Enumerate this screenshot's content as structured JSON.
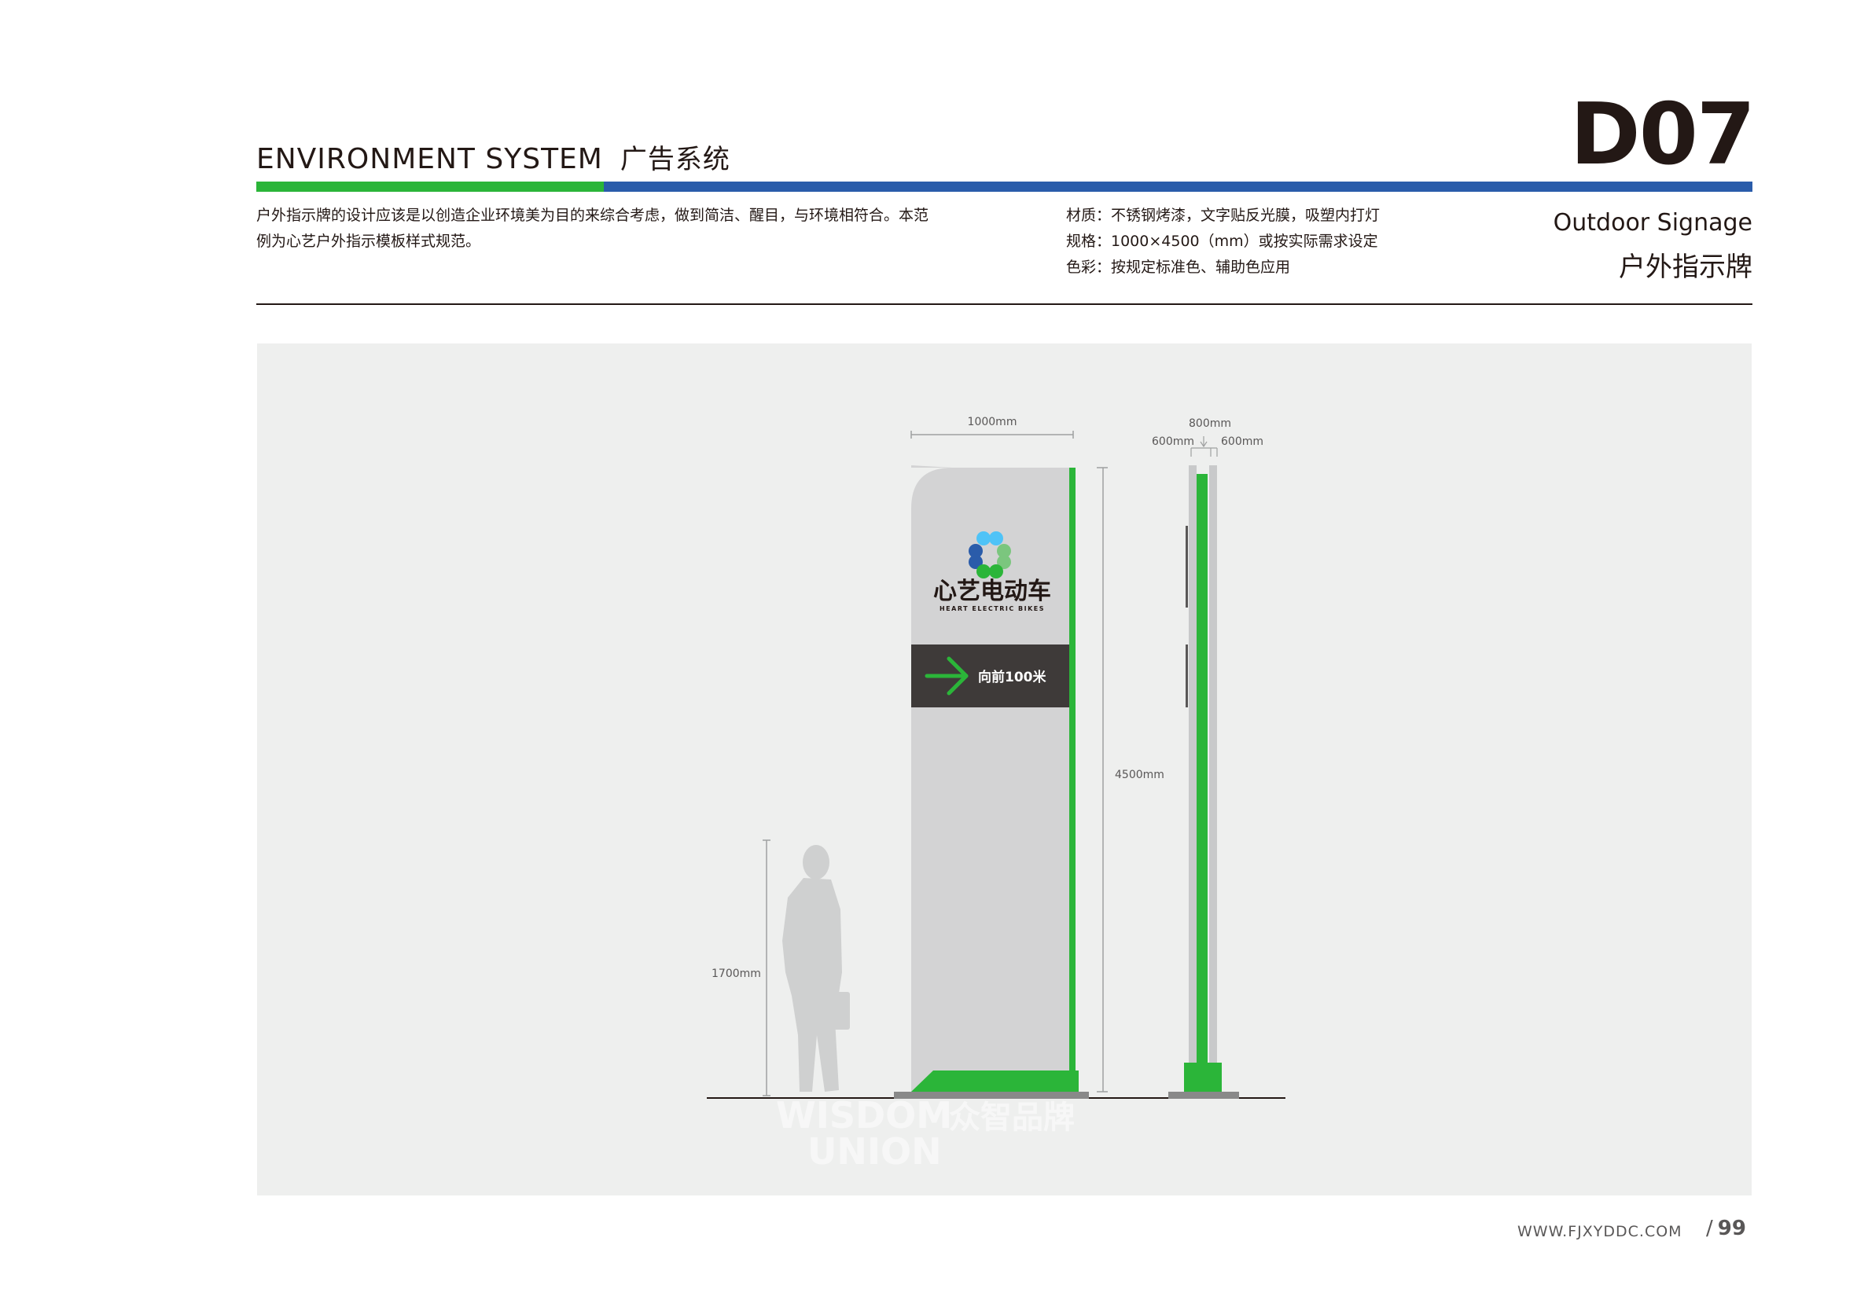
{
  "header": {
    "title_en": "ENVIRONMENT SYSTEM",
    "title_cn": "广告系统",
    "code": "D07"
  },
  "intro": {
    "lines": [
      "户外指示牌的设计应该是以创造企业环境美为目的来综合考虑，做到简洁、醒目，与环境相符合。本范",
      "例为心艺户外指示模板样式规范。"
    ]
  },
  "specs": {
    "material": "材质：不锈钢烤漆，文字贴反光膜，吸塑内打灯",
    "size": "规格：1000×4500（mm）或按实际需求设定",
    "color": "色彩：按规定标准色、辅助色应用"
  },
  "subtitle": {
    "en": "Outdoor Signage",
    "cn": "户外指示牌"
  },
  "drawing": {
    "dim_width": "1000mm",
    "dim_height": "4500mm",
    "dim_person": "1700mm",
    "dim_depth_total": "800mm",
    "dim_depth_left": "600mm",
    "dim_depth_right": "600mm",
    "brand_cn": "心艺电动车",
    "brand_en": "HEART ELECTRIC BIKES",
    "direction_text": "向前100米",
    "watermark_en_1": "WISDOM",
    "watermark_en_2": "UNION",
    "watermark_cn": "众智品牌"
  },
  "colors": {
    "brand_green": "#2bb539",
    "brand_blue": "#2a5caa",
    "sign_body": "#d3d3d4",
    "direction_panel": "#3e3a39",
    "panel_bg": "#eeefee"
  },
  "footer": {
    "url": "WWW.FJXYDDC.COM",
    "slash": "/",
    "page": "99"
  }
}
